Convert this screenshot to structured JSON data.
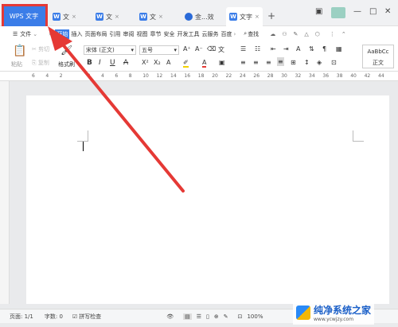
{
  "titlebar": {
    "wps_tab": "WPS 文字",
    "tabs": [
      {
        "label": "文"
      },
      {
        "label": "文"
      },
      {
        "label": "文"
      },
      {
        "label": "金...效"
      },
      {
        "label": "文字"
      }
    ]
  },
  "menu": {
    "file_label": "文件",
    "items": [
      "开始",
      "插入",
      "页面布局",
      "引用",
      "审阅",
      "视图",
      "章节",
      "安全",
      "开发工具",
      "云服务",
      "百度"
    ],
    "search": "查找"
  },
  "ribbon": {
    "paste": "粘贴",
    "cut": "剪切",
    "copy": "复制",
    "format_painter": "格式刷",
    "font": "宋体 (正文)",
    "size": "五号",
    "style_preview": "AaBbCc",
    "style_name": "正文"
  },
  "ruler": {
    "ticks": [
      "6",
      "4",
      "2",
      "",
      "2",
      "4",
      "6",
      "8",
      "10",
      "12",
      "14",
      "16",
      "18",
      "20",
      "22",
      "24",
      "26",
      "28",
      "30",
      "32",
      "34",
      "36",
      "38",
      "40",
      "42",
      "44"
    ]
  },
  "status": {
    "page": "页面: 1/1",
    "words": "字数: 0",
    "spell": "拼写检查",
    "zoom": "100%"
  },
  "watermark": {
    "title": "纯净系统之家",
    "url": "www.ycwjzy.com"
  }
}
